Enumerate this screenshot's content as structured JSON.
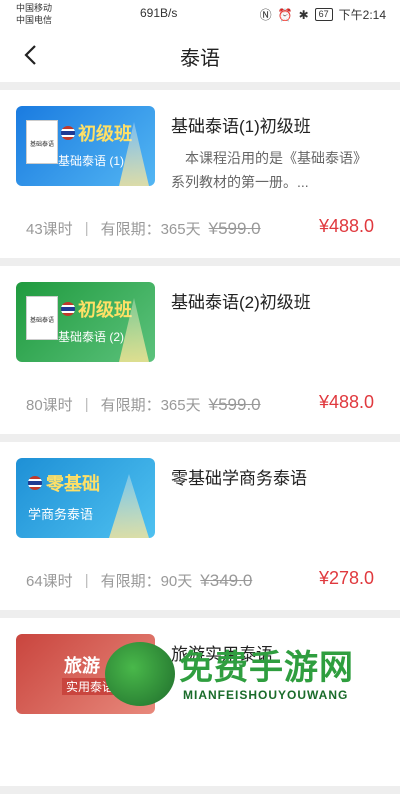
{
  "status": {
    "carrier1": "中国移动",
    "carrier2": "中国电信",
    "speed": "691B/s",
    "battery": "67",
    "time": "下午2:14"
  },
  "nav": {
    "title": "泰语"
  },
  "courses": [
    {
      "thumb_big": "初级班",
      "thumb_small": "基础泰语 (1)",
      "book_label": "基础泰语",
      "title": "基础泰语(1)初级班",
      "desc": "本课程沿用的是《基础泰语》系列教材的第一册。...",
      "lessons": "43课时",
      "validity": "有限期：365天",
      "old_price": "¥599.0",
      "price": "¥488.0"
    },
    {
      "thumb_big": "初级班",
      "thumb_small": "基础泰语 (2)",
      "book_label": "基础泰语",
      "title": "基础泰语(2)初级班",
      "desc": "",
      "lessons": "80课时",
      "validity": "有限期：365天",
      "old_price": "¥599.0",
      "price": "¥488.0"
    },
    {
      "thumb_big": "零基础",
      "thumb_small": "学商务泰语",
      "title": "零基础学商务泰语",
      "desc": "",
      "lessons": "64课时",
      "validity": "有限期：90天",
      "old_price": "¥349.0",
      "price": "¥278.0"
    },
    {
      "thumb_big": "旅游",
      "thumb_small": "实用泰语",
      "title": "旅游实用泰语"
    }
  ],
  "watermark": {
    "text": "免费手游网",
    "sub": "MIANFEISHOUYOUWANG"
  }
}
